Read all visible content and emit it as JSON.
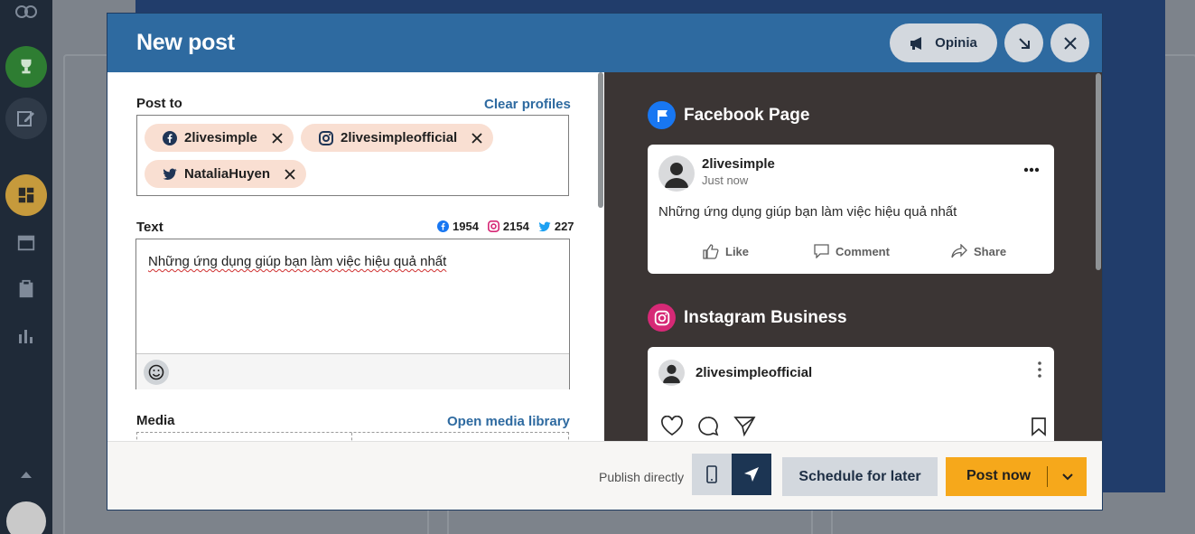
{
  "modal": {
    "title": "New post",
    "opinia_label": "Opinia"
  },
  "post_to": {
    "label": "Post to",
    "clear_label": "Clear profiles",
    "profiles": [
      {
        "network": "facebook",
        "name": "2livesimple",
        "icon": "facebook-icon"
      },
      {
        "network": "instagram",
        "name": "2livesimpleofficial",
        "icon": "instagram-icon"
      },
      {
        "network": "twitter",
        "name": "NataliaHuyen",
        "icon": "twitter-icon"
      }
    ]
  },
  "text_section": {
    "label": "Text",
    "counts": {
      "facebook": "1954",
      "instagram": "2154",
      "twitter": "227"
    },
    "value": "Những ứng dụng giúp bạn làm việc hiệu quả nhất"
  },
  "media": {
    "label": "Media",
    "library_label": "Open media library"
  },
  "preview": {
    "facebook": {
      "network_title": "Facebook Page",
      "author": "2livesimple",
      "time": "Just now",
      "text": "Những ứng dụng giúp bạn làm việc hiệu quả nhất",
      "actions": [
        "Like",
        "Comment",
        "Share"
      ]
    },
    "instagram": {
      "network_title": "Instagram Business",
      "author": "2livesimpleofficial"
    }
  },
  "footer": {
    "publish_label": "Publish directly",
    "schedule_label": "Schedule for later",
    "post_now_label": "Post now"
  },
  "colors": {
    "header": "#2e6aa0",
    "accent": "#f6a81b",
    "chip": "#f9dfd2",
    "preview_bg": "#3b3534",
    "facebook": "#1877f2",
    "instagram": "#d62976"
  }
}
